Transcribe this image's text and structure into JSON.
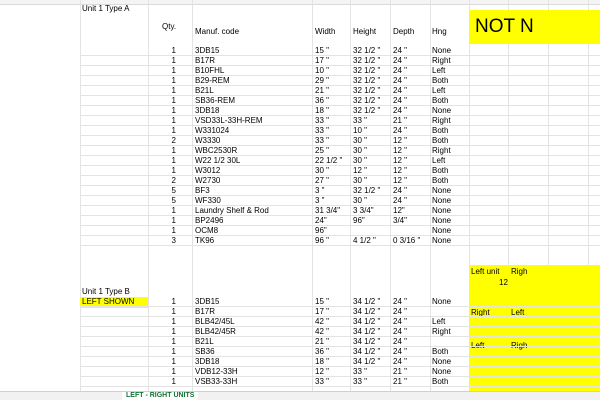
{
  "sections": {
    "a_title": "Unit 1 Type A",
    "b_title": "Unit 1 Type B",
    "b_note": "LEFT SHOWN"
  },
  "headers": {
    "qty": "Qty.",
    "code": "Manuf. code",
    "width": "Width",
    "height": "Height",
    "depth": "Depth",
    "hng": "Hng"
  },
  "banner": "NOT N",
  "side": {
    "left_unit": "Left unit",
    "right_1": "Righ",
    "count": "12",
    "right_2": "Right",
    "left_2": "Left",
    "left_3": "Left",
    "right_3": "Righ"
  },
  "typeA": [
    {
      "qty": "1",
      "code": "3DB15",
      "width": "15 \"",
      "height": "32 1/2 \"",
      "depth": "24 \"",
      "hng": "None"
    },
    {
      "qty": "1",
      "code": "B17R",
      "width": "17 \"",
      "height": "32 1/2 \"",
      "depth": "24 \"",
      "hng": "Right"
    },
    {
      "qty": "1",
      "code": "B10FHL",
      "width": "10 \"",
      "height": "32 1/2 \"",
      "depth": "24 \"",
      "hng": "Left"
    },
    {
      "qty": "1",
      "code": "B29-REM",
      "width": "29 \"",
      "height": "32 1/2 \"",
      "depth": "24 \"",
      "hng": "Both"
    },
    {
      "qty": "1",
      "code": "B21L",
      "width": "21 \"",
      "height": "32 1/2 \"",
      "depth": "24 \"",
      "hng": "Left"
    },
    {
      "qty": "1",
      "code": "SB36-REM",
      "width": "36 \"",
      "height": "32 1/2 \"",
      "depth": "24 \"",
      "hng": "Both"
    },
    {
      "qty": "1",
      "code": "3DB18",
      "width": "18 \"",
      "height": "32 1/2 \"",
      "depth": "24 \"",
      "hng": "None"
    },
    {
      "qty": "1",
      "code": "VSD33L-33H-REM",
      "width": "33 \"",
      "height": "33 \"",
      "depth": "21 \"",
      "hng": "Right"
    },
    {
      "qty": "1",
      "code": "W331024",
      "width": "33 \"",
      "height": "10 \"",
      "depth": "24 \"",
      "hng": "Both"
    },
    {
      "qty": "2",
      "code": "W3330",
      "width": "33 \"",
      "height": "30 \"",
      "depth": "12 \"",
      "hng": "Both"
    },
    {
      "qty": "1",
      "code": "WBC2530R",
      "width": "25 \"",
      "height": "30 \"",
      "depth": "12 \"",
      "hng": "Right"
    },
    {
      "qty": "1",
      "code": "W22 1/2 30L",
      "width": "22 1/2 \"",
      "height": "30 \"",
      "depth": "12 \"",
      "hng": "Left"
    },
    {
      "qty": "1",
      "code": "W3012",
      "width": "30 \"",
      "height": "12 \"",
      "depth": "12 \"",
      "hng": "Both"
    },
    {
      "qty": "2",
      "code": "W2730",
      "width": "27 \"",
      "height": "30 \"",
      "depth": "12 \"",
      "hng": "Both"
    },
    {
      "qty": "5",
      "code": "BF3",
      "width": "3 \"",
      "height": "32 1/2 \"",
      "depth": "24 \"",
      "hng": "None"
    },
    {
      "qty": "5",
      "code": "WF330",
      "width": "3 \"",
      "height": "30 \"",
      "depth": "24 \"",
      "hng": "None"
    },
    {
      "qty": "1",
      "code": "Laundry Shelf & Rod",
      "width": "31 3/4\"",
      "height": "3 3/4\"",
      "depth": "12\"",
      "hng": "None"
    },
    {
      "qty": "1",
      "code": "BP2496",
      "width": "24\"",
      "height": "96\"",
      "depth": "3/4\"",
      "hng": "None"
    },
    {
      "qty": "1",
      "code": "OCM8",
      "width": "96\"",
      "height": "",
      "depth": "",
      "hng": "None"
    },
    {
      "qty": "3",
      "code": "TK96",
      "width": "96 \"",
      "height": "4 1/2 \"",
      "depth": "0 3/16 \"",
      "hng": "None"
    }
  ],
  "typeB": [
    {
      "qty": "1",
      "code": "3DB15",
      "width": "15 \"",
      "height": "34 1/2 \"",
      "depth": "24 \"",
      "hng": "None"
    },
    {
      "qty": "1",
      "code": "B17R",
      "width": "17 \"",
      "height": "34 1/2 \"",
      "depth": "24 \"",
      "hng": ""
    },
    {
      "qty": "1",
      "code": "BLB42/45L",
      "width": "42 \"",
      "height": "34 1/2 \"",
      "depth": "24 \"",
      "hng": "Left"
    },
    {
      "qty": "1",
      "code": "BLB42/45R",
      "width": "42 \"",
      "height": "34 1/2 \"",
      "depth": "24 \"",
      "hng": "Right"
    },
    {
      "qty": "1",
      "code": "B21L",
      "width": "21 \"",
      "height": "34 1/2 \"",
      "depth": "24 \"",
      "hng": ""
    },
    {
      "qty": "1",
      "code": "SB36",
      "width": "36 \"",
      "height": "34 1/2 \"",
      "depth": "24 \"",
      "hng": "Both"
    },
    {
      "qty": "1",
      "code": "3DB18",
      "width": "18 \"",
      "height": "34 1/2 \"",
      "depth": "24 \"",
      "hng": "None"
    },
    {
      "qty": "1",
      "code": "VDB12-33H",
      "width": "12 \"",
      "height": "33 \"",
      "depth": "21 \"",
      "hng": "None"
    },
    {
      "qty": "1",
      "code": "VSB33-33H",
      "width": "33 \"",
      "height": "33 \"",
      "depth": "21 \"",
      "hng": "Both"
    }
  ],
  "tabs": {
    "left": "",
    "active": "LEFT - RIGHT UNITS",
    "right": ""
  }
}
